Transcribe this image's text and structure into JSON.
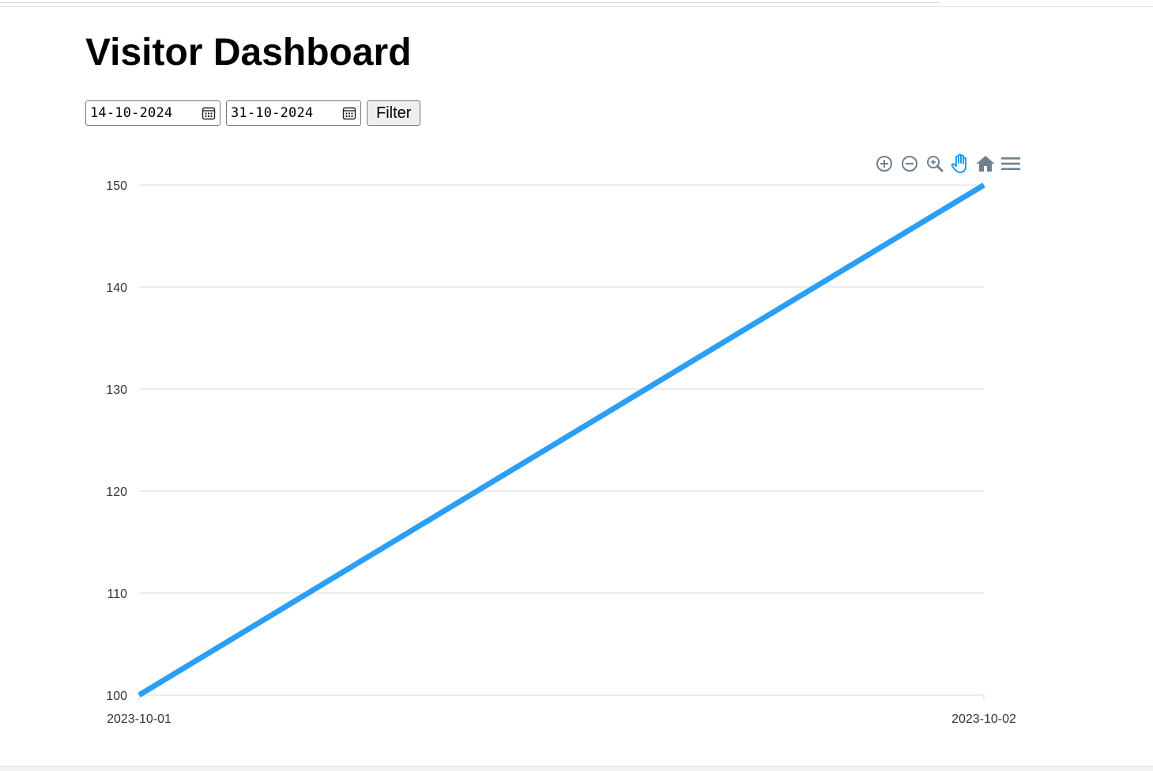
{
  "page": {
    "title": "Visitor Dashboard"
  },
  "filters": {
    "start_date": "14-10-2024",
    "end_date": "31-10-2024",
    "filter_label": "Filter"
  },
  "toolbar": {
    "icons": [
      "zoom-in-icon",
      "zoom-out-icon",
      "selection-zoom-icon",
      "pan-hand-icon",
      "home-reset-icon",
      "menu-icon"
    ],
    "active": "pan-hand-icon"
  },
  "colors": {
    "series": "#2a9ff5",
    "grid": "#e0e0e0",
    "toolbar_icon": "#6e8192",
    "toolbar_active": "#0a8ff3"
  },
  "chart_data": {
    "type": "line",
    "x": [
      "2023-10-01",
      "2023-10-02"
    ],
    "series": [
      {
        "values": [
          100,
          150
        ]
      }
    ],
    "ylim": [
      100,
      150
    ],
    "yticks": [
      "100",
      "110",
      "120",
      "130",
      "140",
      "150"
    ],
    "xticks": [
      "2023-10-01",
      "2023-10-02"
    ],
    "grid": true
  }
}
